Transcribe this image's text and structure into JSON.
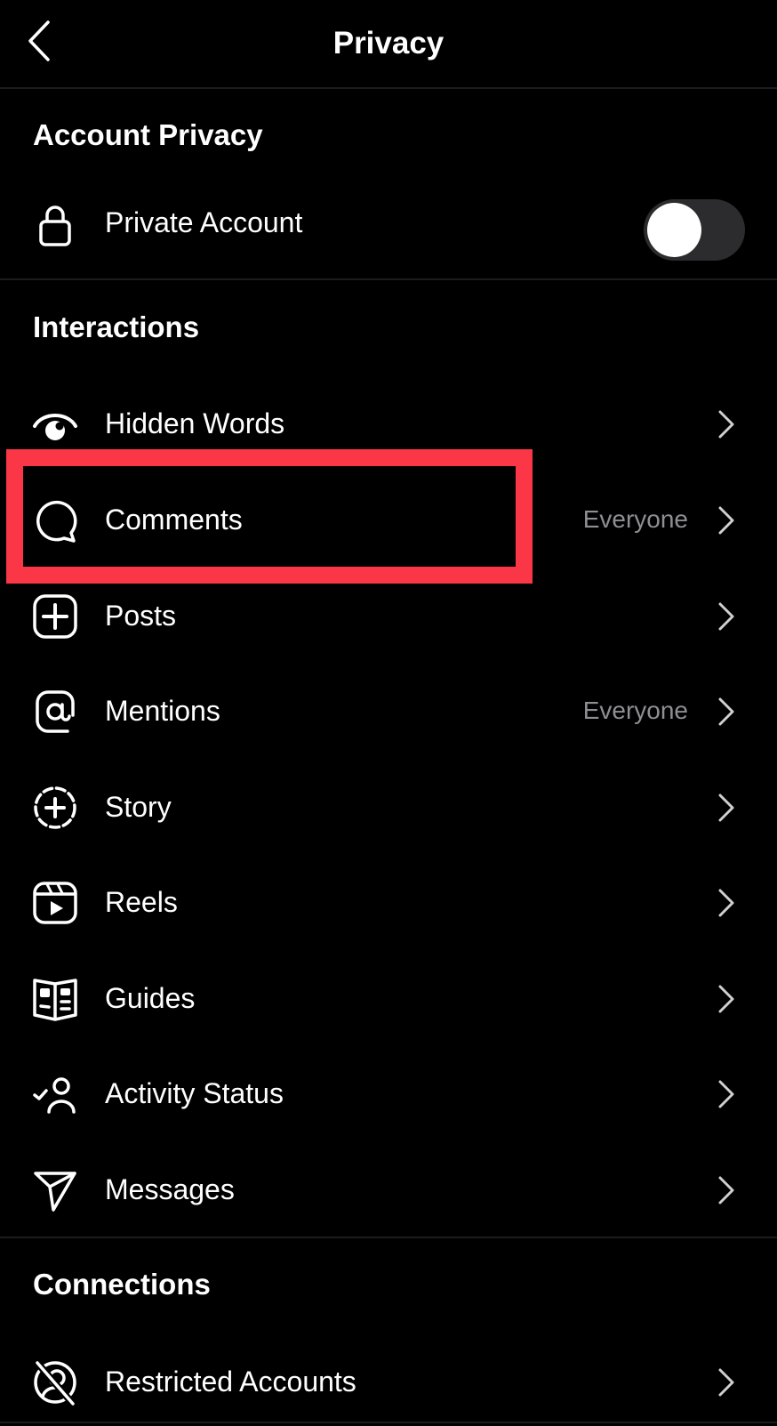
{
  "header": {
    "back_icon": "chevron-left-icon",
    "title": "Privacy"
  },
  "sections": {
    "account_privacy": {
      "title": "Account Privacy",
      "private_account": {
        "icon": "lock-icon",
        "label": "Private Account",
        "toggle_on": false
      }
    },
    "interactions": {
      "title": "Interactions",
      "items": [
        {
          "icon": "hidden-words-eye-icon",
          "label": "Hidden Words",
          "value": ""
        },
        {
          "icon": "comment-bubble-icon",
          "label": "Comments",
          "value": "Everyone"
        },
        {
          "icon": "add-post-icon",
          "label": "Posts",
          "value": ""
        },
        {
          "icon": "at-mention-icon",
          "label": "Mentions",
          "value": "Everyone"
        },
        {
          "icon": "add-story-icon",
          "label": "Story",
          "value": ""
        },
        {
          "icon": "reels-icon",
          "label": "Reels",
          "value": ""
        },
        {
          "icon": "guides-icon",
          "label": "Guides",
          "value": ""
        },
        {
          "icon": "activity-status-icon",
          "label": "Activity Status",
          "value": ""
        },
        {
          "icon": "paper-plane-icon",
          "label": "Messages",
          "value": ""
        }
      ]
    },
    "connections": {
      "title": "Connections",
      "items": [
        {
          "icon": "restricted-accounts-icon",
          "label": "Restricted Accounts",
          "value": ""
        }
      ]
    }
  },
  "highlight": {
    "target": "Comments",
    "color": "#fa3647"
  },
  "colors": {
    "background": "#000000",
    "text": "#ffffff",
    "secondary_text": "#8e8e93",
    "toggle_off": "#2c2c2e",
    "divider": "#1c1c1e"
  }
}
